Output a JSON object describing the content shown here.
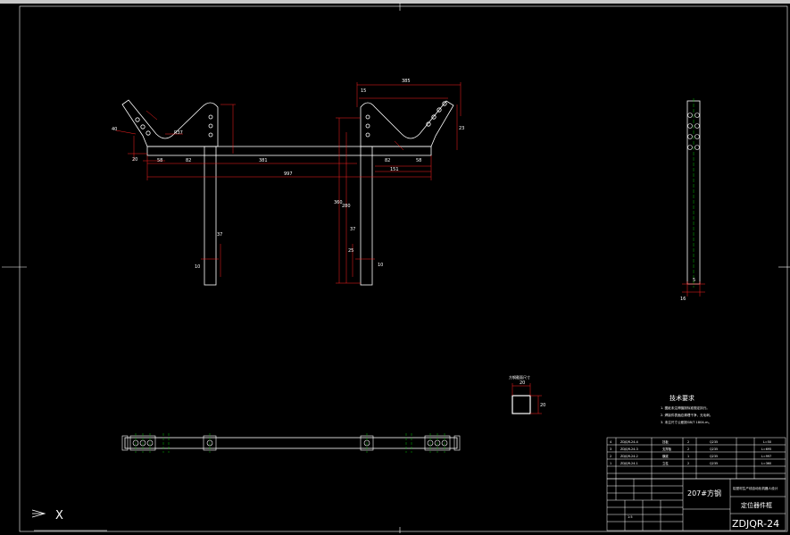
{
  "colors": {
    "background": "#000000",
    "linework": "#ffffff",
    "dimension": "#ff2020",
    "centerline": "#00c000",
    "hidden": "#ffd400"
  },
  "tech_requirements": {
    "title": "技术要求",
    "items": [
      "1. 图纸未注焊缝按标准规定执行。",
      "2. 焊接件表面应清理干净，无毛刺。",
      "3. 未注尺寸公差按GB/T 1804-m。"
    ]
  },
  "parts_table": [
    {
      "no": "4",
      "code": "ZDJQR-24-4",
      "name": "挡板",
      "qty": "2",
      "material": "Q235",
      "note": "L=50"
    },
    {
      "no": "3",
      "code": "ZDJQR-24-3",
      "name": "支撑板",
      "qty": "2",
      "material": "Q235",
      "note": "L=695"
    },
    {
      "no": "2",
      "code": "ZDJQR-24-2",
      "name": "横梁",
      "qty": "1",
      "material": "Q235",
      "note": "L=997"
    },
    {
      "no": "1",
      "code": "ZDJQR-24-1",
      "name": "立柱",
      "qty": "2",
      "material": "Q235",
      "note": "L=360"
    }
  ],
  "title_block": {
    "drawing_name": "定位器件框",
    "project": "207#方钢",
    "designer_company": "铝型材生产线自动化机器人设计",
    "drawing_number": "ZDJQR-24",
    "scale": "1:5"
  },
  "section_label": "方钢截面尺寸",
  "dimensions": {
    "d385": "385",
    "d997": "997",
    "d381": "381",
    "d82": "82",
    "d58": "58",
    "d151": "151",
    "d360": "360",
    "d280": "280",
    "d23": "23",
    "d10": "10",
    "d37": "37",
    "r37": "R37",
    "d20": "20",
    "d40": "40",
    "d25": "25",
    "d5": "5",
    "d16": "16",
    "d15": "15"
  }
}
